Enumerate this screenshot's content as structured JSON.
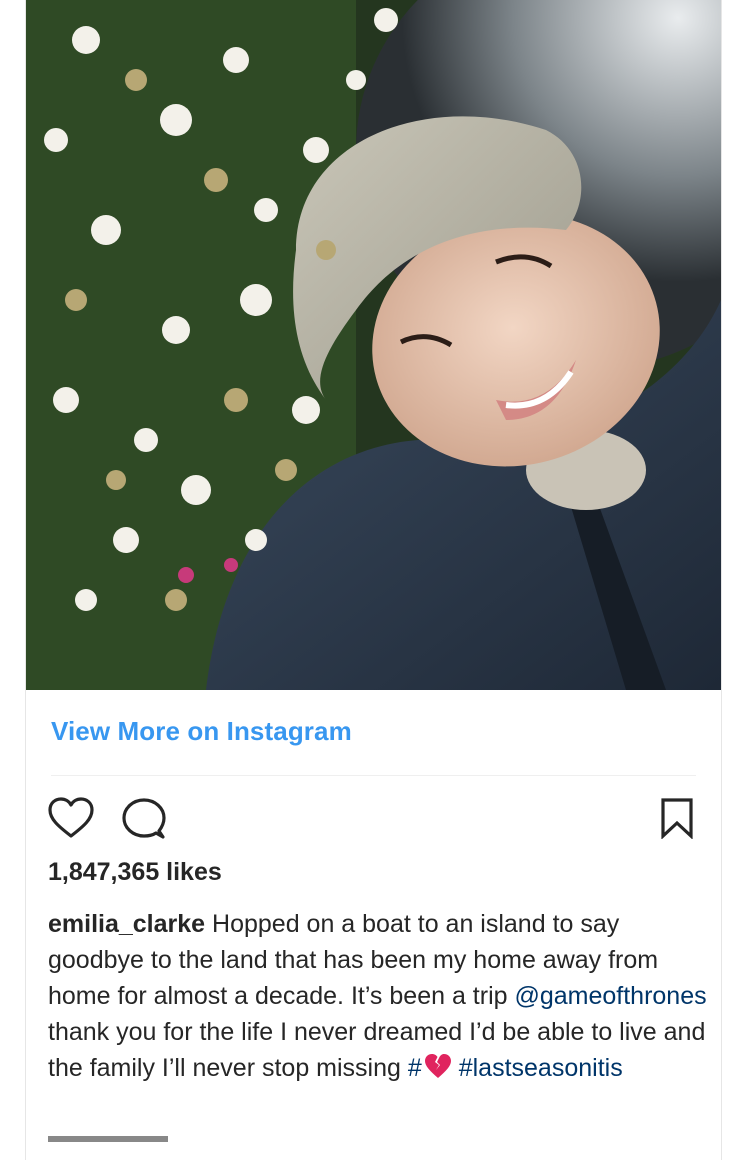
{
  "post": {
    "photo_alt": "selfie photo",
    "view_more_label": "View More on Instagram",
    "likes_text": "1,847,365 likes",
    "caption": {
      "username": "emilia_clarke",
      "text_part1": " Hopped on a boat to an island to say goodbye to the land that has been my home away from home for almost a decade. It’s been a trip ",
      "mention": "@gameofthrones",
      "text_part2": " thank you for the life I never dreamed I’d be able to live and the family I’ll never stop missing ",
      "hashtag_emoji": "#",
      "hashtag": "#lastseasonitis"
    }
  },
  "icons": {
    "like": "heart-outline-icon",
    "comment": "speech-bubble-icon",
    "save": "bookmark-icon",
    "emoji": "broken-heart-icon"
  },
  "colors": {
    "link_blue": "#3897f0",
    "hashtag_blue": "#003569",
    "text_dark": "#262626"
  }
}
